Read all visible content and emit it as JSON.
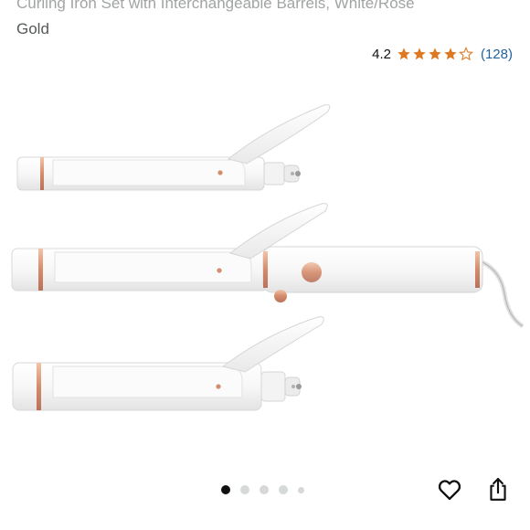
{
  "product": {
    "title_line1": "Curling Iron Set with Interchangeable Barrels, White/Rose",
    "title_line2": "Gold"
  },
  "rating": {
    "value": "4.2",
    "stars": 4.2,
    "reviews": "(128)",
    "star_color": "#de7921"
  },
  "gallery": {
    "total_images": 5,
    "active_index": 0
  },
  "icons": {
    "wishlist": "heart-icon",
    "share": "share-icon"
  }
}
